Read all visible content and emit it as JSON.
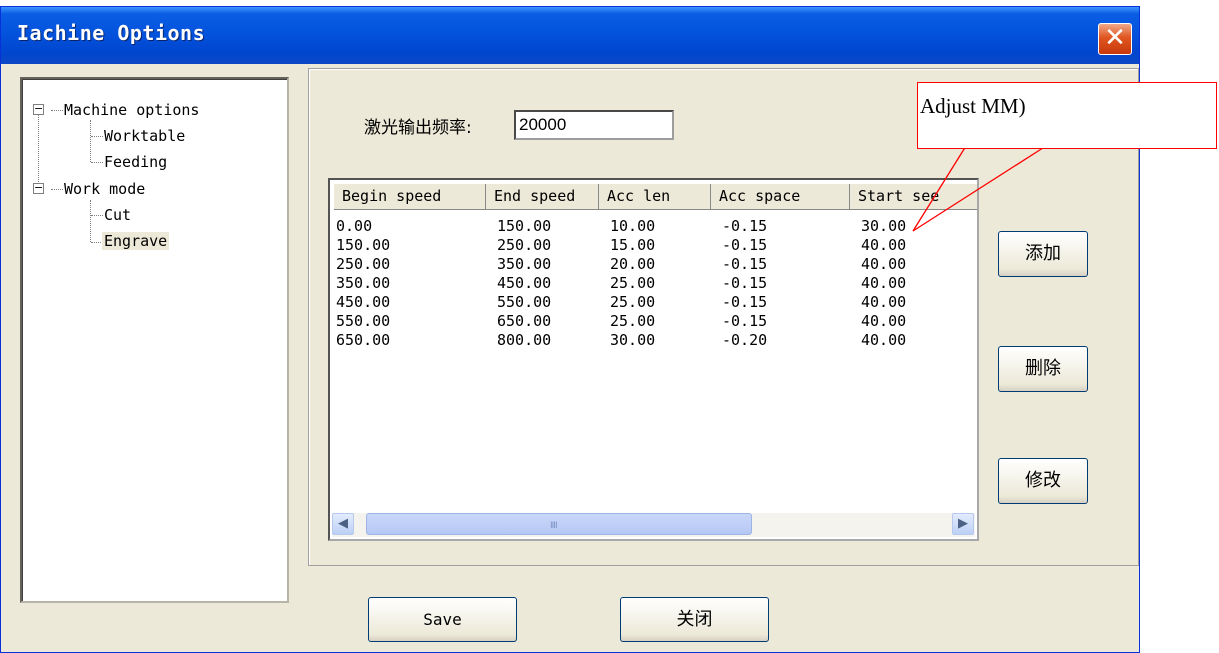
{
  "window": {
    "title": "Iachine Options",
    "close_glyph": "✕"
  },
  "tree": {
    "items": [
      {
        "label": "Machine options",
        "expander": "−"
      },
      {
        "label": "Worktable"
      },
      {
        "label": "Feeding"
      },
      {
        "label": "Work mode",
        "expander": "−"
      },
      {
        "label": "Cut"
      },
      {
        "label": "Engrave"
      }
    ]
  },
  "freq": {
    "label": "激光输出频率:",
    "value": "20000"
  },
  "table": {
    "columns": [
      "Begin speed",
      "End speed",
      "Acc len",
      "Acc space",
      "Start see"
    ],
    "rows": [
      [
        "0.00",
        "150.00",
        "10.00",
        "-0.15",
        "30.00"
      ],
      [
        "150.00",
        "250.00",
        "15.00",
        "-0.15",
        "40.00"
      ],
      [
        "250.00",
        "350.00",
        "20.00",
        "-0.15",
        "40.00"
      ],
      [
        "350.00",
        "450.00",
        "25.00",
        "-0.15",
        "40.00"
      ],
      [
        "450.00",
        "550.00",
        "25.00",
        "-0.15",
        "40.00"
      ],
      [
        "550.00",
        "650.00",
        "25.00",
        "-0.15",
        "40.00"
      ],
      [
        "650.00",
        "800.00",
        "30.00",
        "-0.20",
        "40.00"
      ]
    ],
    "scroll_left": "◀",
    "scroll_right": "▶",
    "thumb_grip": "IIII"
  },
  "buttons": {
    "add": "添加",
    "delete": "删除",
    "modify": "修改",
    "save": "Save",
    "close": "关闭"
  },
  "callout": {
    "text": "Adjust MM)"
  },
  "colors": {
    "title_bar": "#0453dd",
    "dialog_bg": "#ece9d8",
    "callout_border": "#ff0000"
  }
}
